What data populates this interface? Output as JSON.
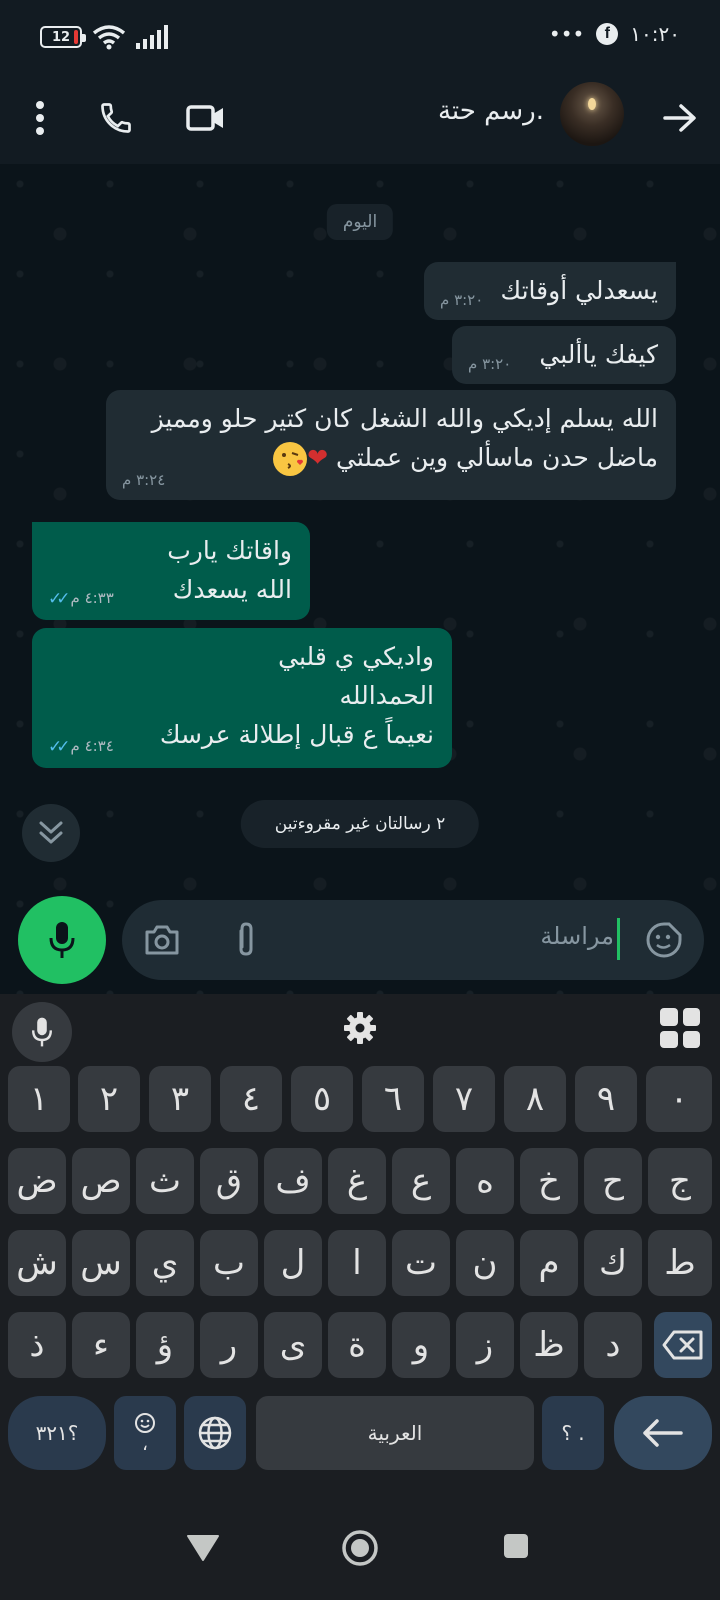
{
  "status_bar": {
    "time": "١٠:٢٠",
    "dots": "•••",
    "battery_level": "12"
  },
  "header": {
    "contact_name": ".رسم حتة"
  },
  "chat": {
    "date_label": "اليوم",
    "messages": [
      {
        "direction": "incoming",
        "text": "يسعدلي أوقاتك",
        "time": "٣:٢٠ م"
      },
      {
        "direction": "incoming",
        "text": "كيفك ياألبي",
        "time": "٣:٢٠ م"
      },
      {
        "direction": "incoming",
        "text": "الله يسلم إديكي والله الشغل كان كتير حلو ومميز\nماضل حدن ماسألي وين عملتي",
        "emoji": "❤",
        "time": "٣:٢٤ م"
      },
      {
        "direction": "outgoing",
        "text": "واقاتك يارب\nالله يسعدك",
        "time": "٤:٣٣ م",
        "ticks": "✓✓"
      },
      {
        "direction": "outgoing",
        "text": "واديكي ي قلبي\nالحمدالله\nنعيماً ع قبال إطلالة عرسك",
        "time": "٤:٣٤ م",
        "ticks": "✓✓"
      }
    ],
    "unread_label": "٢ رسالتان غير مقروءتين"
  },
  "input": {
    "placeholder": "مراسلة"
  },
  "keyboard": {
    "row_digits": [
      "١",
      "٢",
      "٣",
      "٤",
      "٥",
      "٦",
      "٧",
      "٨",
      "٩",
      "٠"
    ],
    "row1": [
      "ض",
      "ص",
      "ث",
      "ق",
      "ف",
      "غ",
      "ع",
      "ه",
      "خ",
      "ح",
      "ج"
    ],
    "row2": [
      "ش",
      "س",
      "ي",
      "ب",
      "ل",
      "ا",
      "ت",
      "ن",
      "م",
      "ك",
      "ط"
    ],
    "row3": [
      "ذ",
      "ء",
      "ؤ",
      "ر",
      "ى",
      "ة",
      "و",
      "ز",
      "ظ",
      "د"
    ],
    "symbols_key": "؟٣٢١",
    "emoji_key_sub": "،",
    "space_label": "العربية",
    "punct_key": "؟ .",
    "enter_arrow": "↩"
  },
  "colors": {
    "accent_green": "#21c063",
    "outgoing_bubble": "#005c4b",
    "incoming_bubble": "#202c33",
    "read_ticks": "#53bdeb"
  }
}
